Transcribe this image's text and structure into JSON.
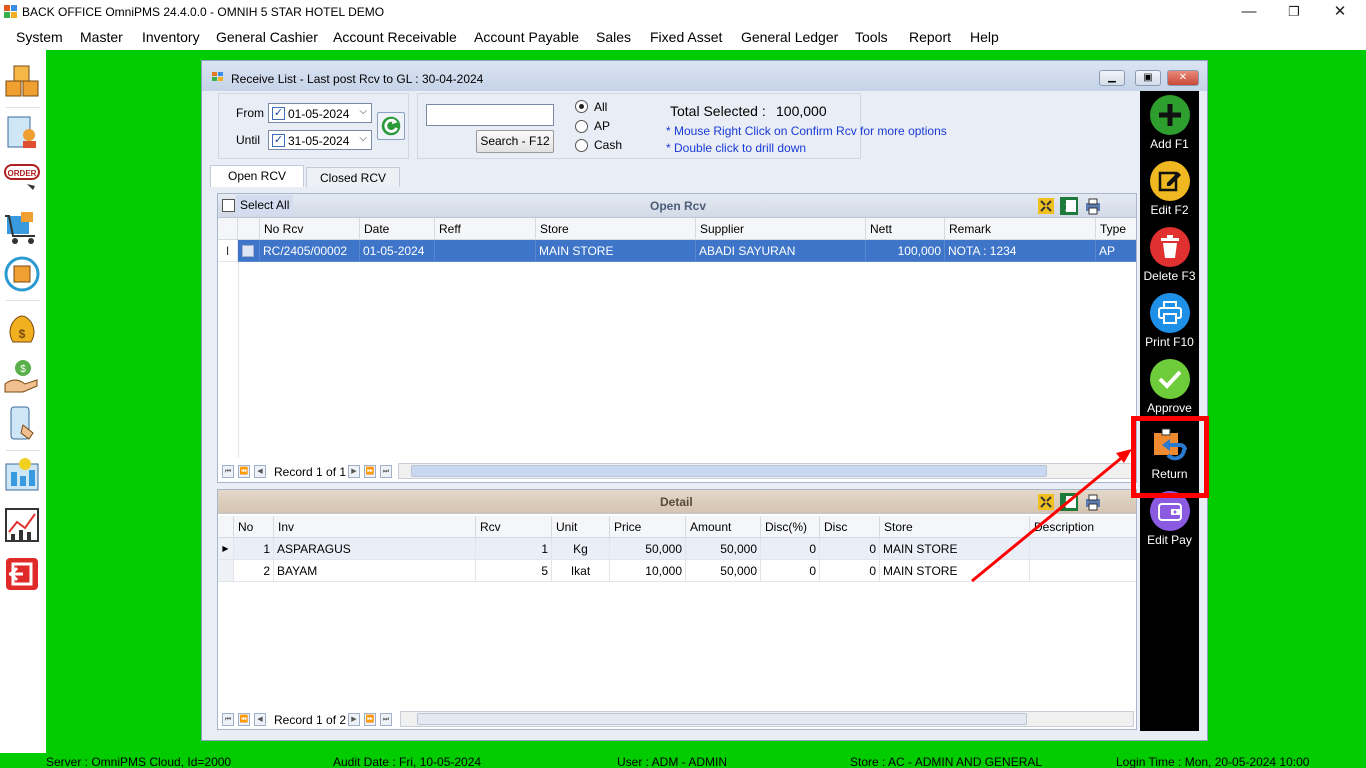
{
  "titlebar": {
    "title": "BACK OFFICE OmniPMS 24.4.0.0 - OMNIH 5 STAR HOTEL DEMO",
    "minimize": "—",
    "restore": "❐",
    "close": "✕"
  },
  "menu": [
    "System",
    "Master",
    "Inventory",
    "General Cashier",
    "Account Receivable",
    "Account Payable",
    "Sales",
    "Fixed Asset",
    "General Ledger",
    "Tools",
    "Report",
    "Help"
  ],
  "window": {
    "title": "Receive List - Last post Rcv to GL : 30-04-2024",
    "filter": {
      "from_label": "From",
      "from_value": "01-05-2024",
      "until_label": "Until",
      "until_value": "31-05-2024",
      "search_value": "",
      "search_button": "Search - F12",
      "radio_all": "All",
      "radio_ap": "AP",
      "radio_cash": "Cash",
      "total_label": "Total Selected :",
      "total_value": "100,000",
      "note1": "* Mouse Right Click on Confirm Rcv for more options",
      "note2": "* Double click to drill down"
    },
    "tabs": [
      "Open RCV",
      "Closed RCV"
    ],
    "open_grid": {
      "title": "Open Rcv",
      "select_all": "Select All",
      "columns": [
        "No Rcv",
        "Date",
        "Reff",
        "Store",
        "Supplier",
        "Nett",
        "Remark",
        "Type"
      ],
      "rows": [
        {
          "no": "RC/2405/00002",
          "date": "01-05-2024",
          "reff": "",
          "store": "MAIN STORE",
          "supplier": "ABADI SAYURAN",
          "nett": "100,000",
          "remark": "NOTA : 1234",
          "type": "AP"
        }
      ],
      "record": "Record 1 of 1"
    },
    "detail_grid": {
      "title": "Detail",
      "columns": [
        "No",
        "Inv",
        "Rcv",
        "Unit",
        "Price",
        "Amount",
        "Disc(%)",
        "Disc",
        "Store",
        "Description"
      ],
      "rows": [
        {
          "no": "1",
          "inv": "ASPARAGUS",
          "rcv": "1",
          "unit": "Kg",
          "price": "50,000",
          "amount": "50,000",
          "discp": "0",
          "disc": "0",
          "store": "MAIN STORE",
          "desc": ""
        },
        {
          "no": "2",
          "inv": "BAYAM",
          "rcv": "5",
          "unit": "Ikat",
          "price": "10,000",
          "amount": "50,000",
          "discp": "0",
          "disc": "0",
          "store": "MAIN STORE",
          "desc": ""
        }
      ],
      "record": "Record 1 of 2"
    },
    "actions": [
      {
        "label": "Add F1",
        "icon": "add-icon",
        "color": "#2e9e2e"
      },
      {
        "label": "Edit F2",
        "icon": "edit-icon",
        "color": "#f0b820"
      },
      {
        "label": "Delete F3",
        "icon": "trash-icon",
        "color": "#e03030"
      },
      {
        "label": "Print F10",
        "icon": "printer-icon",
        "color": "#1e90e8"
      },
      {
        "label": "Approve",
        "icon": "check-icon",
        "color": "#6ecb3a"
      },
      {
        "label": "Return",
        "icon": "return-icon",
        "color": "#f08a30"
      },
      {
        "label": "Edit Pay",
        "icon": "wallet-icon",
        "color": "#8a5ae0"
      }
    ]
  },
  "status": {
    "server": "Server : OmniPMS Cloud, Id=2000",
    "audit": "Audit Date : Fri, 10-05-2024",
    "user": "User : ADM - ADMIN",
    "store": "Store : AC - ADMIN AND GENERAL",
    "login": "Login Time : Mon, 20-05-2024 10:00"
  }
}
